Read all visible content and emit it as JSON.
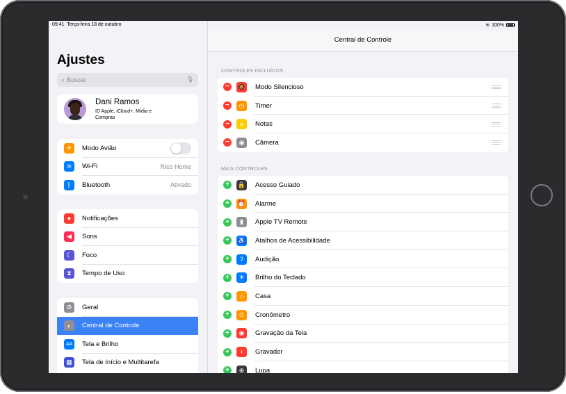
{
  "status": {
    "time": "09:41",
    "date": "Terça-feira 18 de outubro",
    "battery": "100%"
  },
  "sidebar": {
    "title": "Ajustes",
    "search_placeholder": "Buscar",
    "profile": {
      "name": "Dani Ramos",
      "subtitle": "ID Apple, iCloud+, Mídia e Compras"
    },
    "group1": [
      {
        "label": "Modo Avião",
        "icon": "airplane-icon",
        "color": "#ff9500",
        "glyph": "✈",
        "toggle": false
      },
      {
        "label": "Wi-Fi",
        "icon": "wifi-icon",
        "color": "#007aff",
        "glyph": "≋",
        "value": "Rico Home"
      },
      {
        "label": "Bluetooth",
        "icon": "bluetooth-icon",
        "color": "#007aff",
        "glyph": "ᛒ",
        "value": "Ativado"
      }
    ],
    "group2": [
      {
        "label": "Notificações",
        "icon": "notifications-icon",
        "color": "#ff3b30",
        "glyph": "●"
      },
      {
        "label": "Sons",
        "icon": "sounds-icon",
        "color": "#ff2d55",
        "glyph": "◀"
      },
      {
        "label": "Foco",
        "icon": "focus-moon-icon",
        "color": "#5856d6",
        "glyph": "☾"
      },
      {
        "label": "Tempo de Uso",
        "icon": "screen-time-icon",
        "color": "#5856d6",
        "glyph": "⧗"
      }
    ],
    "group3": [
      {
        "label": "Geral",
        "icon": "gear-icon",
        "color": "#8e8e93",
        "glyph": "⚙"
      },
      {
        "label": "Central de Controle",
        "icon": "control-center-icon",
        "color": "#8e8e93",
        "glyph": "◐",
        "selected": true
      },
      {
        "label": "Tela e Brilho",
        "icon": "display-brightness-icon",
        "color": "#007aff",
        "glyph": "AA"
      },
      {
        "label": "Tela de Início e Multitarefa",
        "icon": "home-screen-icon",
        "color": "#3f51d6",
        "glyph": "▦"
      }
    ]
  },
  "main": {
    "title": "Central de Controle",
    "included_header": "CONTROLES INCLUÍDOS",
    "included": [
      {
        "label": "Modo Silencioso",
        "icon": "silent-bell-icon",
        "color": "#ff3b30",
        "glyph": "🔕"
      },
      {
        "label": "Timer",
        "icon": "timer-icon",
        "color": "#ff9500",
        "glyph": "◷"
      },
      {
        "label": "Notas",
        "icon": "notes-icon",
        "color": "#ffcc00",
        "glyph": "≡"
      },
      {
        "label": "Câmera",
        "icon": "camera-icon",
        "color": "#8e8e93",
        "glyph": "◉"
      }
    ],
    "more_header": "MAIS CONTROLES",
    "more": [
      {
        "label": "Acesso Guiado",
        "icon": "guided-access-lock-icon",
        "color": "#3a3a3c",
        "glyph": "🔒"
      },
      {
        "label": "Alarme",
        "icon": "alarm-clock-icon",
        "color": "#ff9500",
        "glyph": "⏰"
      },
      {
        "label": "Apple TV Remote",
        "icon": "apple-tv-remote-icon",
        "color": "#8e8e93",
        "glyph": "▮"
      },
      {
        "label": "Atalhos de Acessibilidade",
        "icon": "accessibility-icon",
        "color": "#007aff",
        "glyph": "♿"
      },
      {
        "label": "Audição",
        "icon": "hearing-ear-icon",
        "color": "#007aff",
        "glyph": "ʔ"
      },
      {
        "label": "Brilho do Teclado",
        "icon": "keyboard-brightness-icon",
        "color": "#007aff",
        "glyph": "☀"
      },
      {
        "label": "Casa",
        "icon": "home-icon",
        "color": "#ff9500",
        "glyph": "⌂"
      },
      {
        "label": "Cronômetro",
        "icon": "stopwatch-icon",
        "color": "#ff9500",
        "glyph": "⏱"
      },
      {
        "label": "Gravação da Tela",
        "icon": "screen-recording-icon",
        "color": "#ff3b30",
        "glyph": "◉"
      },
      {
        "label": "Gravador",
        "icon": "voice-memos-icon",
        "color": "#ff3b30",
        "glyph": "≀"
      },
      {
        "label": "Lupa",
        "icon": "magnifier-icon",
        "color": "#3a3a3c",
        "glyph": "⊕"
      }
    ]
  }
}
